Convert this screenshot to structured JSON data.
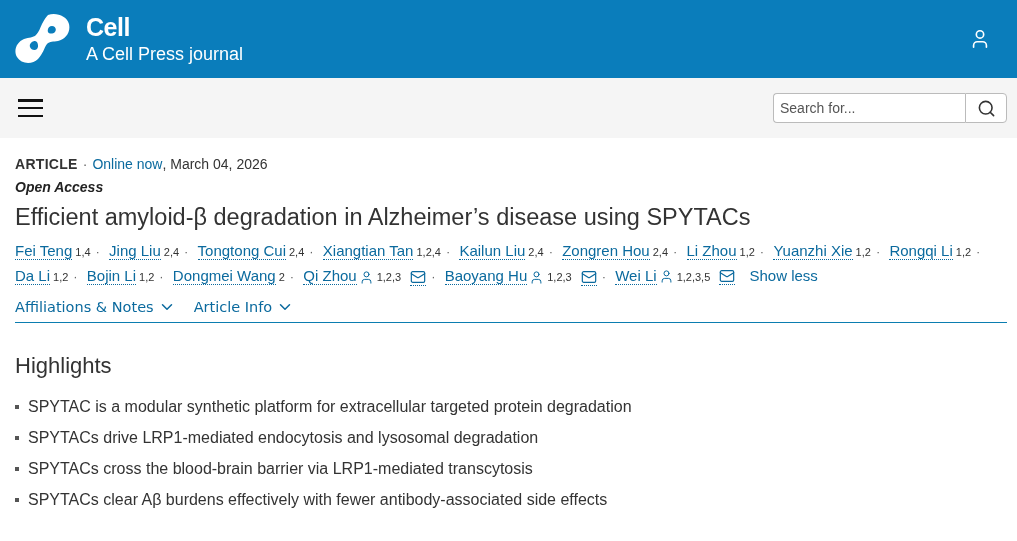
{
  "header": {
    "journal": "Cell",
    "subtitle": "A Cell Press journal"
  },
  "search": {
    "placeholder": "Search for..."
  },
  "article": {
    "type": "ARTICLE",
    "separator": "·",
    "online_label": "Online now",
    "date": ", March 04, 2026",
    "access": "Open Access",
    "title": "Efficient amyloid-β degradation in Alzheimer’s disease using SPYTACs",
    "author_separator": "·",
    "authors": [
      {
        "name": "Fei Teng",
        "marks": "1,4",
        "corresponding": false
      },
      {
        "name": "Jing Liu",
        "marks": "2,4",
        "corresponding": false
      },
      {
        "name": "Tongtong Cui",
        "marks": "2,4",
        "corresponding": false
      },
      {
        "name": "Xiangtian Tan",
        "marks": "1,2,4",
        "corresponding": false
      },
      {
        "name": "Kailun Liu",
        "marks": "2,4",
        "corresponding": false
      },
      {
        "name": "Zongren Hou",
        "marks": "2,4",
        "corresponding": false
      },
      {
        "name": "Li Zhou",
        "marks": "1,2",
        "corresponding": false
      },
      {
        "name": "Yuanzhi Xie",
        "marks": "1,2",
        "corresponding": false
      },
      {
        "name": "Rongqi Li",
        "marks": "1,2",
        "corresponding": false
      },
      {
        "name": "Da Li",
        "marks": "1,2",
        "corresponding": false
      },
      {
        "name": "Bojin Li",
        "marks": "1,2",
        "corresponding": false
      },
      {
        "name": "Dongmei Wang",
        "marks": "2",
        "corresponding": false
      },
      {
        "name": "Qi Zhou",
        "marks": "1,2,3",
        "corresponding": true
      },
      {
        "name": "Baoyang Hu",
        "marks": "1,2,3",
        "corresponding": true
      },
      {
        "name": "Wei Li",
        "marks": "1,2,3,5",
        "corresponding": true
      }
    ],
    "show_less": "Show less",
    "toggles": [
      {
        "label": "Affiliations & Notes",
        "expanded": false
      },
      {
        "label": "Article Info",
        "expanded": false
      }
    ]
  },
  "highlights": {
    "heading": "Highlights",
    "items": [
      "SPYTAC is a modular synthetic platform for extracellular targeted protein degradation",
      "SPYTACs drive LRP1-mediated endocytosis and lysosomal degradation",
      "SPYTACs cross the blood-brain barrier via LRP1-mediated transcytosis",
      "SPYTACs clear Aβ burdens effectively with fewer antibody-associated side effects"
    ]
  }
}
